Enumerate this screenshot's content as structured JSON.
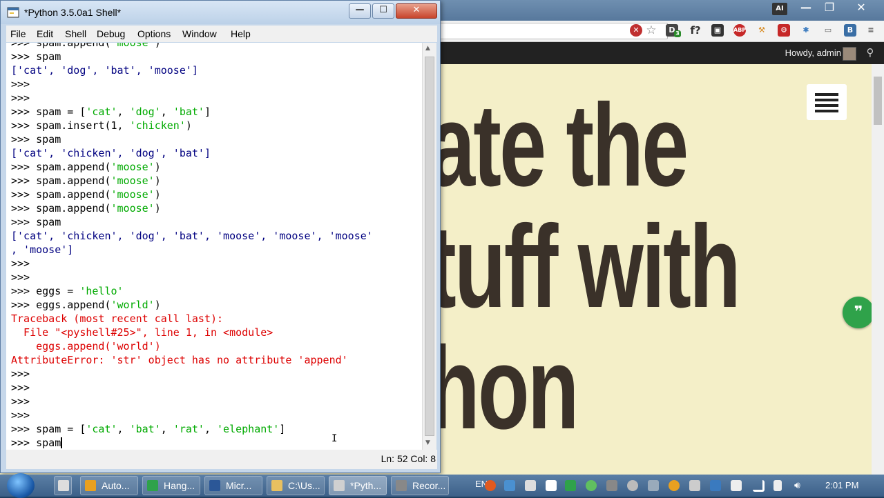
{
  "browser": {
    "admin_greeting": "Howdy, admin",
    "hero_lines": [
      "ate the",
      "tuff with",
      "hon"
    ],
    "chat_icon": "quote-chat-icon",
    "ext_badge": "3"
  },
  "idle": {
    "title": "*Python 3.5.0a1 Shell*",
    "menu": [
      "File",
      "Edit",
      "Shell",
      "Debug",
      "Options",
      "Window",
      "Help"
    ],
    "status": "Ln: 52 Col: 8",
    "lines": [
      {
        "p": ">>> ",
        "t": "spam.append('moose')",
        "k": "partial"
      },
      {
        "p": ">>> ",
        "t": "spam"
      },
      {
        "p": "",
        "t": "['cat', 'dog', 'bat', 'moose']",
        "k": "out"
      },
      {
        "p": ">>> ",
        "t": ""
      },
      {
        "p": ">>> ",
        "t": ""
      },
      {
        "p": ">>> ",
        "t": "spam = ['cat', 'dog', 'bat']"
      },
      {
        "p": ">>> ",
        "t": "spam.insert(1, 'chicken')"
      },
      {
        "p": ">>> ",
        "t": "spam"
      },
      {
        "p": "",
        "t": "['cat', 'chicken', 'dog', 'bat']",
        "k": "out"
      },
      {
        "p": ">>> ",
        "t": "spam.append('moose')"
      },
      {
        "p": ">>> ",
        "t": "spam.append('moose')"
      },
      {
        "p": ">>> ",
        "t": "spam.append('moose')"
      },
      {
        "p": ">>> ",
        "t": "spam.append('moose')"
      },
      {
        "p": ">>> ",
        "t": "spam"
      },
      {
        "p": "",
        "t": "['cat', 'chicken', 'dog', 'bat', 'moose', 'moose', 'moose'",
        "k": "out"
      },
      {
        "p": "",
        "t": ", 'moose']",
        "k": "out"
      },
      {
        "p": ">>> ",
        "t": ""
      },
      {
        "p": ">>> ",
        "t": ""
      },
      {
        "p": ">>> ",
        "t": "eggs = 'hello'"
      },
      {
        "p": ">>> ",
        "t": "eggs.append('world')"
      },
      {
        "p": "",
        "t": "Traceback (most recent call last):",
        "k": "err"
      },
      {
        "p": "",
        "t": "  File \"<pyshell#25>\", line 1, in <module>",
        "k": "err"
      },
      {
        "p": "",
        "t": "    eggs.append('world')",
        "k": "err"
      },
      {
        "p": "",
        "t": "AttributeError: 'str' object has no attribute 'append'",
        "k": "err"
      },
      {
        "p": ">>> ",
        "t": ""
      },
      {
        "p": ">>> ",
        "t": ""
      },
      {
        "p": ">>> ",
        "t": ""
      },
      {
        "p": ">>> ",
        "t": ""
      },
      {
        "p": ">>> ",
        "t": "spam = ['cat', 'bat', 'rat', 'elephant']"
      },
      {
        "p": ">>> ",
        "t": "spam",
        "k": "cursor"
      }
    ]
  },
  "taskbar": {
    "items": [
      {
        "label": "Auto...",
        "icon": "chrome-icon",
        "color": "#e8a020"
      },
      {
        "label": "Hang...",
        "icon": "hangouts-icon",
        "color": "#2fa24a"
      },
      {
        "label": "Micr...",
        "icon": "word-icon",
        "color": "#2b5797"
      },
      {
        "label": "C:\\Us...",
        "icon": "folder-icon",
        "color": "#e8c060"
      },
      {
        "label": "*Pyth...",
        "icon": "python-icon",
        "color": "#d0d0d0"
      },
      {
        "label": "Recor...",
        "icon": "recorder-icon",
        "color": "#888888"
      }
    ],
    "language": "EN",
    "clock": "2:01 PM"
  }
}
